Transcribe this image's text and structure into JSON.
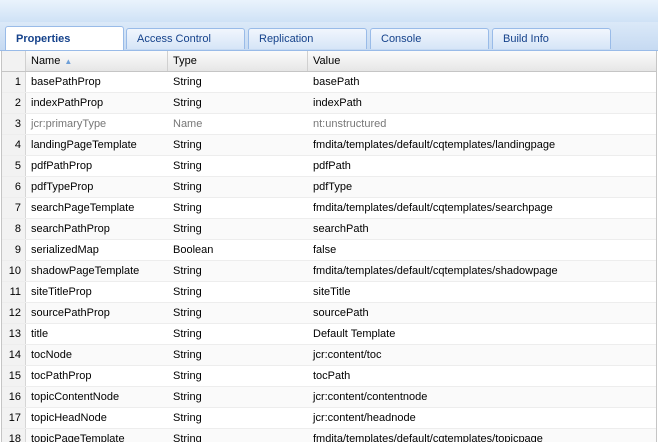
{
  "tabs": [
    {
      "label": "Properties",
      "active": true
    },
    {
      "label": "Access Control",
      "active": false
    },
    {
      "label": "Replication",
      "active": false
    },
    {
      "label": "Console",
      "active": false
    },
    {
      "label": "Build Info",
      "active": false
    }
  ],
  "grid": {
    "columns": [
      "Name",
      "Type",
      "Value"
    ],
    "sort_icon": "sort-ascending-icon",
    "rows": [
      {
        "num": "1",
        "name": "basePathProp",
        "type": "String",
        "value": "basePath",
        "dim": false
      },
      {
        "num": "2",
        "name": "indexPathProp",
        "type": "String",
        "value": "indexPath",
        "dim": false
      },
      {
        "num": "3",
        "name": "jcr:primaryType",
        "type": "Name",
        "value": "nt:unstructured",
        "dim": true
      },
      {
        "num": "4",
        "name": "landingPageTemplate",
        "type": "String",
        "value": "fmdita/templates/default/cqtemplates/landingpage",
        "dim": false
      },
      {
        "num": "5",
        "name": "pdfPathProp",
        "type": "String",
        "value": "pdfPath",
        "dim": false
      },
      {
        "num": "6",
        "name": "pdfTypeProp",
        "type": "String",
        "value": "pdfType",
        "dim": false
      },
      {
        "num": "7",
        "name": "searchPageTemplate",
        "type": "String",
        "value": "fmdita/templates/default/cqtemplates/searchpage",
        "dim": false
      },
      {
        "num": "8",
        "name": "searchPathProp",
        "type": "String",
        "value": "searchPath",
        "dim": false
      },
      {
        "num": "9",
        "name": "serializedMap",
        "type": "Boolean",
        "value": "false",
        "dim": false
      },
      {
        "num": "10",
        "name": "shadowPageTemplate",
        "type": "String",
        "value": "fmdita/templates/default/cqtemplates/shadowpage",
        "dim": false
      },
      {
        "num": "11",
        "name": "siteTitleProp",
        "type": "String",
        "value": "siteTitle",
        "dim": false
      },
      {
        "num": "12",
        "name": "sourcePathProp",
        "type": "String",
        "value": "sourcePath",
        "dim": false
      },
      {
        "num": "13",
        "name": "title",
        "type": "String",
        "value": "Default Template",
        "dim": false
      },
      {
        "num": "14",
        "name": "tocNode",
        "type": "String",
        "value": "jcr:content/toc",
        "dim": false
      },
      {
        "num": "15",
        "name": "tocPathProp",
        "type": "String",
        "value": "tocPath",
        "dim": false
      },
      {
        "num": "16",
        "name": "topicContentNode",
        "type": "String",
        "value": "jcr:content/contentnode",
        "dim": false
      },
      {
        "num": "17",
        "name": "topicHeadNode",
        "type": "String",
        "value": "jcr:content/headnode",
        "dim": false
      },
      {
        "num": "18",
        "name": "topicPageTemplate",
        "type": "String",
        "value": "fmdita/templates/default/cqtemplates/topicpage",
        "dim": false
      }
    ]
  }
}
